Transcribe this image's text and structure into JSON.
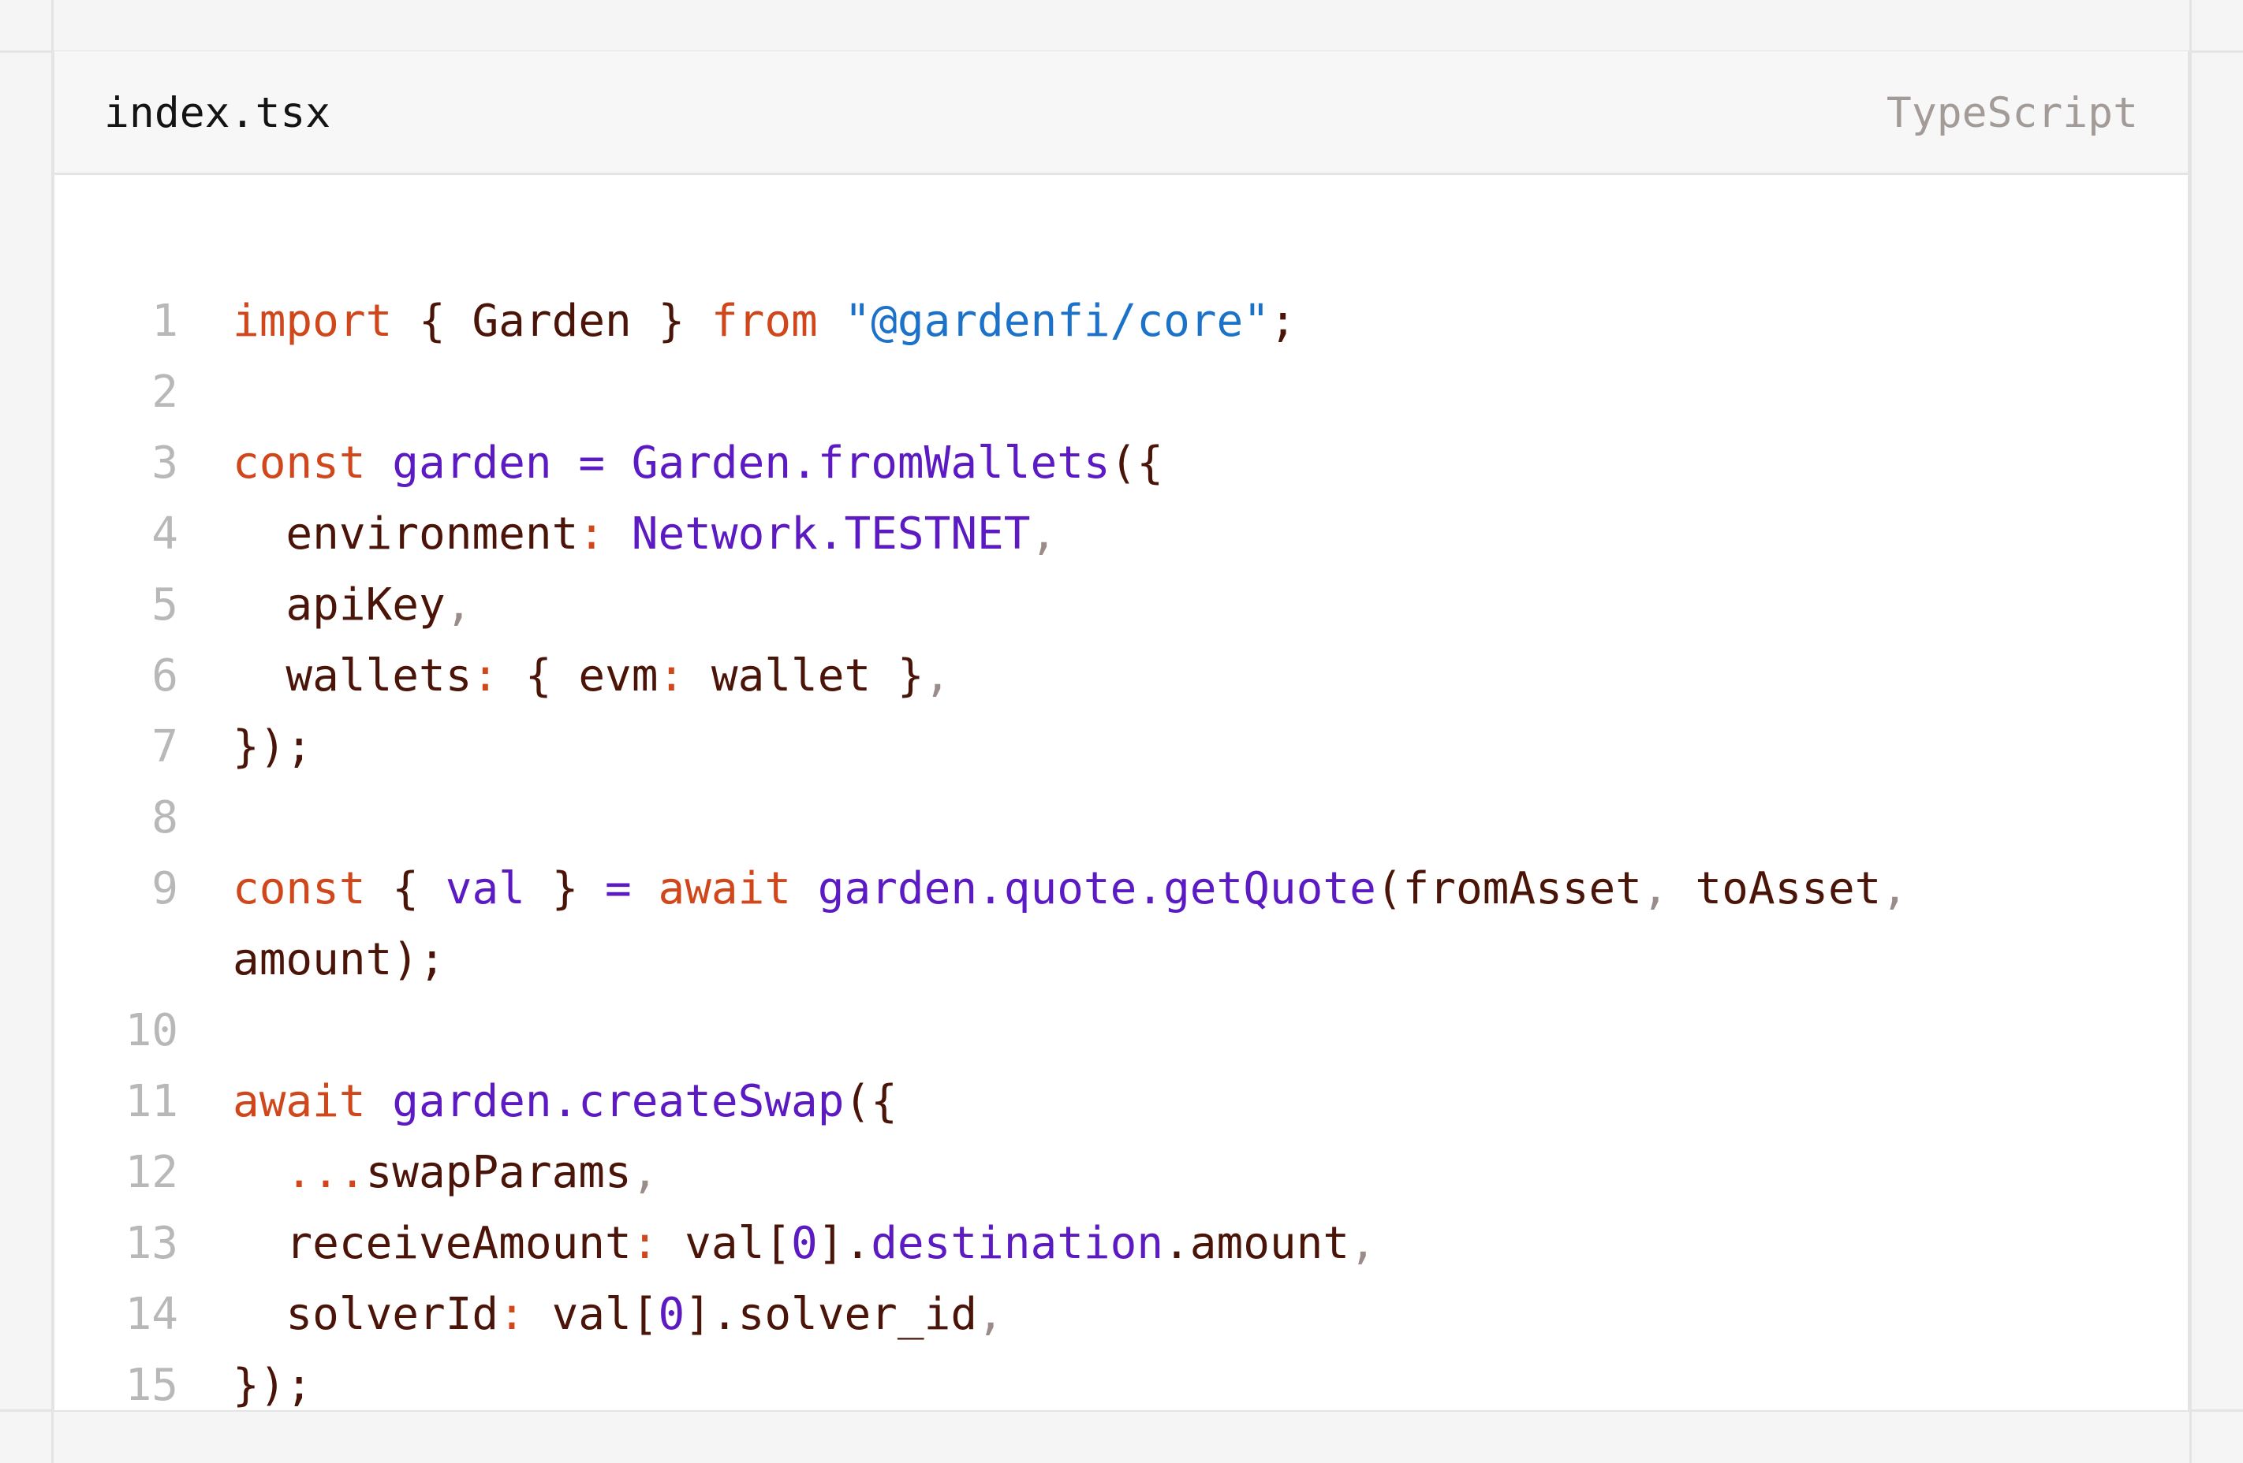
{
  "header": {
    "file_name": "index.tsx",
    "language": "TypeScript"
  },
  "theme": {
    "keyword": "#d0471c",
    "string": "#1c72c9",
    "function": "#5c1ac2",
    "text": "#4a1408",
    "line_number": "#b8b8b8",
    "comma": "#9a8c88"
  },
  "code": {
    "lines": [
      {
        "number": "1",
        "tokens": [
          {
            "t": "import",
            "c": "kw"
          },
          {
            "t": " { ",
            "c": "pun"
          },
          {
            "t": "Garden",
            "c": "txt"
          },
          {
            "t": " } ",
            "c": "pun"
          },
          {
            "t": "from",
            "c": "kw"
          },
          {
            "t": " ",
            "c": "pun"
          },
          {
            "t": "\"@gardenfi/core\"",
            "c": "str"
          },
          {
            "t": ";",
            "c": "pun"
          }
        ]
      },
      {
        "number": "2",
        "tokens": []
      },
      {
        "number": "3",
        "tokens": [
          {
            "t": "const",
            "c": "kw"
          },
          {
            "t": " ",
            "c": "pun"
          },
          {
            "t": "garden",
            "c": "fn"
          },
          {
            "t": " ",
            "c": "pun"
          },
          {
            "t": "=",
            "c": "fn"
          },
          {
            "t": " ",
            "c": "pun"
          },
          {
            "t": "Garden",
            "c": "fn"
          },
          {
            "t": ".",
            "c": "fn"
          },
          {
            "t": "fromWallets",
            "c": "fn"
          },
          {
            "t": "({",
            "c": "pun"
          }
        ]
      },
      {
        "number": "4",
        "tokens": [
          {
            "t": "  environment",
            "c": "txt"
          },
          {
            "t": ":",
            "c": "op"
          },
          {
            "t": " ",
            "c": "pun"
          },
          {
            "t": "Network.TESTNET",
            "c": "fn"
          },
          {
            "t": ",",
            "c": "dim"
          }
        ]
      },
      {
        "number": "5",
        "tokens": [
          {
            "t": "  apiKey",
            "c": "txt"
          },
          {
            "t": ",",
            "c": "dim"
          }
        ]
      },
      {
        "number": "6",
        "tokens": [
          {
            "t": "  wallets",
            "c": "txt"
          },
          {
            "t": ":",
            "c": "op"
          },
          {
            "t": " { ",
            "c": "pun"
          },
          {
            "t": "evm",
            "c": "txt"
          },
          {
            "t": ":",
            "c": "op"
          },
          {
            "t": " wallet }",
            "c": "txt"
          },
          {
            "t": ",",
            "c": "dim"
          }
        ]
      },
      {
        "number": "7",
        "tokens": [
          {
            "t": "});",
            "c": "pun"
          }
        ]
      },
      {
        "number": "8",
        "tokens": []
      },
      {
        "number": "9",
        "tokens": [
          {
            "t": "const",
            "c": "kw"
          },
          {
            "t": " { ",
            "c": "pun"
          },
          {
            "t": "val",
            "c": "fn"
          },
          {
            "t": " } ",
            "c": "pun"
          },
          {
            "t": "=",
            "c": "fn"
          },
          {
            "t": " ",
            "c": "pun"
          },
          {
            "t": "await",
            "c": "kw"
          },
          {
            "t": " ",
            "c": "pun"
          },
          {
            "t": "garden.quote.getQuote",
            "c": "fn"
          },
          {
            "t": "(fromAsset",
            "c": "txt"
          },
          {
            "t": ",",
            "c": "dim"
          },
          {
            "t": " toAsset",
            "c": "txt"
          },
          {
            "t": ",",
            "c": "dim"
          }
        ]
      },
      {
        "number": "",
        "tokens": [
          {
            "t": "amount);",
            "c": "txt"
          }
        ]
      },
      {
        "number": "10",
        "tokens": []
      },
      {
        "number": "11",
        "tokens": [
          {
            "t": "await",
            "c": "kw"
          },
          {
            "t": " ",
            "c": "pun"
          },
          {
            "t": "garden.createSwap",
            "c": "fn"
          },
          {
            "t": "({",
            "c": "pun"
          }
        ]
      },
      {
        "number": "12",
        "tokens": [
          {
            "t": "  ...",
            "c": "op"
          },
          {
            "t": "swapParams",
            "c": "txt"
          },
          {
            "t": ",",
            "c": "dim"
          }
        ]
      },
      {
        "number": "13",
        "tokens": [
          {
            "t": "  receiveAmount",
            "c": "txt"
          },
          {
            "t": ":",
            "c": "op"
          },
          {
            "t": " val[",
            "c": "txt"
          },
          {
            "t": "0",
            "c": "fn"
          },
          {
            "t": "].",
            "c": "txt"
          },
          {
            "t": "destination",
            "c": "fn"
          },
          {
            "t": ".amount",
            "c": "txt"
          },
          {
            "t": ",",
            "c": "dim"
          }
        ]
      },
      {
        "number": "14",
        "tokens": [
          {
            "t": "  solverId",
            "c": "txt"
          },
          {
            "t": ":",
            "c": "op"
          },
          {
            "t": " val[",
            "c": "txt"
          },
          {
            "t": "0",
            "c": "fn"
          },
          {
            "t": "].solver_id",
            "c": "txt"
          },
          {
            "t": ",",
            "c": "dim"
          }
        ]
      },
      {
        "number": "15",
        "tokens": [
          {
            "t": "});",
            "c": "pun"
          }
        ]
      }
    ]
  }
}
